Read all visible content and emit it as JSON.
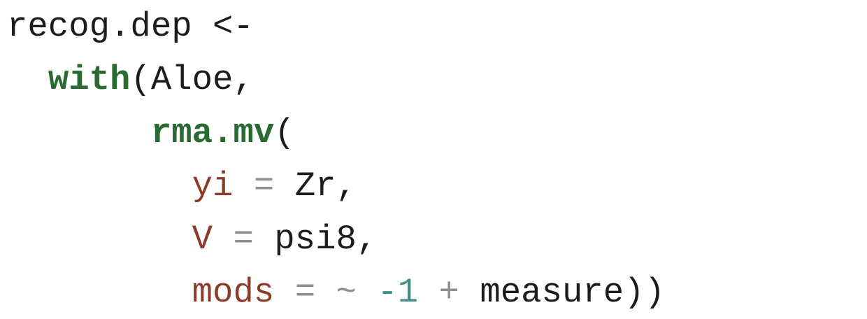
{
  "code": {
    "line1": {
      "text": "recog.dep <-"
    },
    "line2": {
      "keyword": "with",
      "rest": "(Aloe,"
    },
    "line3": {
      "keyword": "rma.mv",
      "rest": "("
    },
    "line4": {
      "arg": "yi",
      "op": "=",
      "value": "Zr,"
    },
    "line5": {
      "arg": "V",
      "op": "=",
      "value": "psi8,"
    },
    "line6": {
      "arg": "mods",
      "op": "=",
      "tilde": "~",
      "number": "-1",
      "plus": "+",
      "value": "measure))"
    }
  },
  "colors": {
    "keyword": "#2a6a33",
    "argument": "#8a3b2a",
    "operator": "#8e8e8e",
    "number": "#3f8f88",
    "text": "#1c1c1c",
    "background": "#ffffff"
  }
}
